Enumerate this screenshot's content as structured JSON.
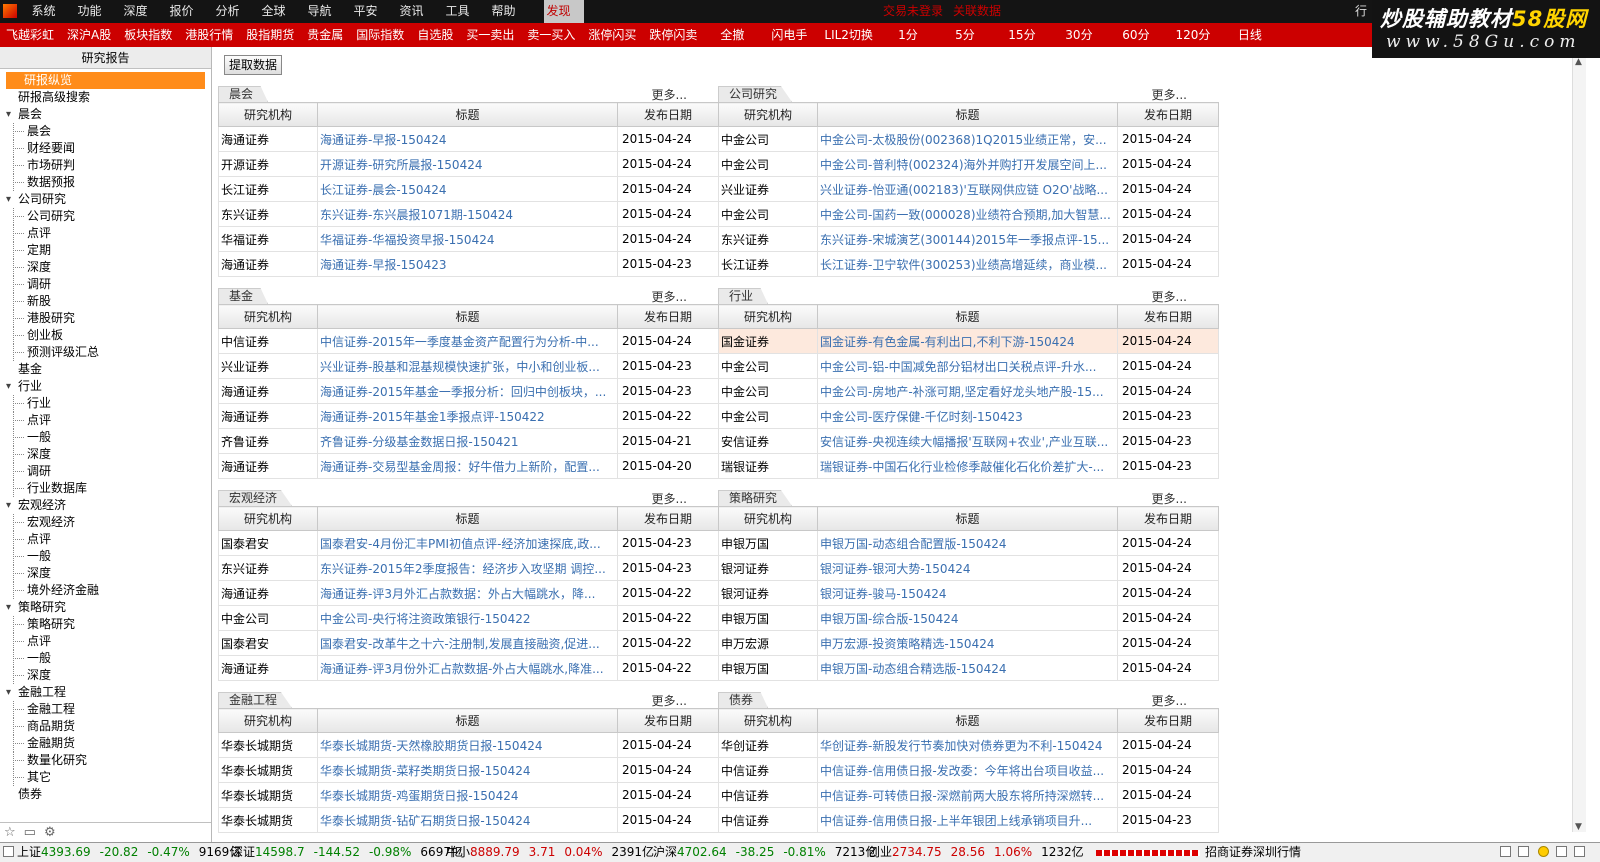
{
  "menubar": {
    "items": [
      "系统",
      "功能",
      "深度",
      "报价",
      "分析",
      "全球",
      "导航",
      "平安",
      "资讯",
      "工具",
      "帮助"
    ],
    "active": "发现",
    "center_links": [
      "交易未登录",
      "关联数据"
    ],
    "right": "行"
  },
  "watermark": {
    "line1_a": "炒股辅助教材",
    "line1_b": "58股网",
    "line2": "www.58Gu.com"
  },
  "toolbar": {
    "items": [
      "飞越彩虹",
      "深沪A股",
      "板块指数",
      "港股行情",
      "股指期货",
      "贵金属",
      "国际指数",
      "自选股",
      "买一卖出",
      "卖一买入",
      "涨停闪买",
      "跌停闪卖",
      "全撤",
      "闪电手",
      "LIL2切换",
      "1分",
      "5分",
      "15分",
      "30分",
      "60分",
      "120分",
      "日线"
    ]
  },
  "sidebar": {
    "title": "研究报告",
    "tree": [
      {
        "label": "研报纵览",
        "level": 0,
        "sel": true
      },
      {
        "label": "研报高级搜索",
        "level": 0
      },
      {
        "label": "晨会",
        "level": 0,
        "toggle": true
      },
      {
        "label": "晨会",
        "level": 1
      },
      {
        "label": "财经要闻",
        "level": 1
      },
      {
        "label": "市场研判",
        "level": 1
      },
      {
        "label": "数据预报",
        "level": 1
      },
      {
        "label": "公司研究",
        "level": 0,
        "toggle": true
      },
      {
        "label": "公司研究",
        "level": 1
      },
      {
        "label": "点评",
        "level": 1
      },
      {
        "label": "定期",
        "level": 1
      },
      {
        "label": "深度",
        "level": 1
      },
      {
        "label": "调研",
        "level": 1
      },
      {
        "label": "新股",
        "level": 1
      },
      {
        "label": "港股研究",
        "level": 1
      },
      {
        "label": "创业板",
        "level": 1
      },
      {
        "label": "预测评级汇总",
        "level": 1
      },
      {
        "label": "基金",
        "level": 0
      },
      {
        "label": "行业",
        "level": 0,
        "toggle": true
      },
      {
        "label": "行业",
        "level": 1
      },
      {
        "label": "点评",
        "level": 1
      },
      {
        "label": "一般",
        "level": 1
      },
      {
        "label": "深度",
        "level": 1
      },
      {
        "label": "调研",
        "level": 1
      },
      {
        "label": "行业数据库",
        "level": 1
      },
      {
        "label": "宏观经济",
        "level": 0,
        "toggle": true
      },
      {
        "label": "宏观经济",
        "level": 1
      },
      {
        "label": "点评",
        "level": 1
      },
      {
        "label": "一般",
        "level": 1
      },
      {
        "label": "深度",
        "level": 1
      },
      {
        "label": "境外经济金融",
        "level": 1
      },
      {
        "label": "策略研究",
        "level": 0,
        "toggle": true
      },
      {
        "label": "策略研究",
        "level": 1
      },
      {
        "label": "点评",
        "level": 1
      },
      {
        "label": "一般",
        "level": 1
      },
      {
        "label": "深度",
        "level": 1
      },
      {
        "label": "金融工程",
        "level": 0,
        "toggle": true
      },
      {
        "label": "金融工程",
        "level": 1
      },
      {
        "label": "商品期货",
        "level": 1
      },
      {
        "label": "金融期货",
        "level": 1
      },
      {
        "label": "数量化研究",
        "level": 1
      },
      {
        "label": "其它",
        "level": 1
      },
      {
        "label": "债券",
        "level": 0
      }
    ]
  },
  "main": {
    "extract_button": "提取数据",
    "more_label": "更多...",
    "headers": [
      "研究机构",
      "标题",
      "发布日期"
    ],
    "panels": [
      {
        "name": "晨会",
        "rows": [
          [
            "海通证券",
            "海通证券-早报-150424",
            "2015-04-24"
          ],
          [
            "开源证券",
            "开源证券-研究所晨报-150424",
            "2015-04-24"
          ],
          [
            "长江证券",
            "长江证券-晨会-150424",
            "2015-04-24"
          ],
          [
            "东兴证券",
            "东兴证券-东兴晨报1071期-150424",
            "2015-04-24"
          ],
          [
            "华福证券",
            "华福证券-华福投资早报-150424",
            "2015-04-24"
          ],
          [
            "海通证券",
            "海通证券-早报-150423",
            "2015-04-23"
          ]
        ]
      },
      {
        "name": "公司研究",
        "rows": [
          [
            "中金公司",
            "中金公司-太极股份(002368)1Q2015业绩正常，安...",
            "2015-04-24"
          ],
          [
            "中金公司",
            "中金公司-普利特(002324)海外并购打开发展空间上...",
            "2015-04-24"
          ],
          [
            "兴业证券",
            "兴业证券-怡亚通(002183)'互联网供应链 O2O'战略...",
            "2015-04-24"
          ],
          [
            "中金公司",
            "中金公司-国药一致(000028)业绩符合预期,加大智慧...",
            "2015-04-24"
          ],
          [
            "东兴证券",
            "东兴证券-宋城演艺(300144)2015年一季报点评-15...",
            "2015-04-24"
          ],
          [
            "长江证券",
            "长江证券-卫宁软件(300253)业绩高增延续，商业模...",
            "2015-04-24"
          ]
        ]
      },
      {
        "name": "基金",
        "rows": [
          [
            "中信证券",
            "中信证券-2015年一季度基金资产配置行为分析-中...",
            "2015-04-24"
          ],
          [
            "兴业证券",
            "兴业证券-股基和混基规模快速扩张，中小和创业板...",
            "2015-04-23"
          ],
          [
            "海通证券",
            "海通证券-2015年基金一季报分析：回归中创板块，...",
            "2015-04-23"
          ],
          [
            "海通证券",
            "海通证券-2015年基金1季报点评-150422",
            "2015-04-22"
          ],
          [
            "齐鲁证券",
            "齐鲁证券-分级基金数据日报-150421",
            "2015-04-21"
          ],
          [
            "海通证券",
            "海通证券-交易型基金周报：好牛借力上新阶，配置...",
            "2015-04-20"
          ]
        ]
      },
      {
        "name": "行业",
        "rows": [
          [
            "国金证券",
            "国金证券-有色金属-有利出口,不利下游-150424",
            "2015-04-24"
          ],
          [
            "中金公司",
            "中金公司-铝-中国减免部分铝材出口关税点评-升水...",
            "2015-04-24"
          ],
          [
            "中金公司",
            "中金公司-房地产-补涨可期,坚定看好龙头地产股-15...",
            "2015-04-24"
          ],
          [
            "中金公司",
            "中金公司-医疗保健-千亿时刻-150423",
            "2015-04-23"
          ],
          [
            "安信证券",
            "安信证券-央视连续大幅播报'互联网+农业',产业互联...",
            "2015-04-23"
          ],
          [
            "瑞银证券",
            "瑞银证券-中国石化行业检修季敲催化石化价差扩大-...",
            "2015-04-23"
          ]
        ]
      },
      {
        "name": "宏观经济",
        "rows": [
          [
            "国泰君安",
            "国泰君安-4月份汇丰PMI初值点评-经济加速探底,政...",
            "2015-04-23"
          ],
          [
            "东兴证券",
            "东兴证券-2015年2季度报告：经济步入攻坚期 调控...",
            "2015-04-23"
          ],
          [
            "海通证券",
            "海通证券-评3月外汇占款数据：外占大幅跳水，降...",
            "2015-04-22"
          ],
          [
            "中金公司",
            "中金公司-央行将注资政策银行-150422",
            "2015-04-22"
          ],
          [
            "国泰君安",
            "国泰君安-改革牛之十六-注册制,发展直接融资,促进...",
            "2015-04-22"
          ],
          [
            "海通证券",
            "海通证券-评3月份外汇占款数据-外占大幅跳水,降准...",
            "2015-04-22"
          ]
        ]
      },
      {
        "name": "策略研究",
        "rows": [
          [
            "申银万国",
            "申银万国-动态组合配置版-150424",
            "2015-04-24"
          ],
          [
            "银河证券",
            "银河证券-银河大势-150424",
            "2015-04-24"
          ],
          [
            "银河证券",
            "银河证券-骏马-150424",
            "2015-04-24"
          ],
          [
            "申银万国",
            "申银万国-综合版-150424",
            "2015-04-24"
          ],
          [
            "申万宏源",
            "申万宏源-投资策略精选-150424",
            "2015-04-24"
          ],
          [
            "申银万国",
            "申银万国-动态组合精选版-150424",
            "2015-04-24"
          ]
        ]
      },
      {
        "name": "金融工程",
        "rows": [
          [
            "华泰长城期货",
            "华泰长城期货-天然橡胶期货日报-150424",
            "2015-04-24"
          ],
          [
            "华泰长城期货",
            "华泰长城期货-菜籽类期货日报-150424",
            "2015-04-24"
          ],
          [
            "华泰长城期货",
            "华泰长城期货-鸡蛋期货日报-150424",
            "2015-04-24"
          ],
          [
            "华泰长城期货",
            "华泰长城期货-钻矿石期货日报-150424",
            "2015-04-24"
          ]
        ]
      },
      {
        "name": "债券",
        "rows": [
          [
            "华创证券",
            "华创证券-新股发行节奏加快对债券更为不利-150424",
            "2015-04-24"
          ],
          [
            "中信证券",
            "中信证券-信用债日报-发改委：今年将出台项目收益...",
            "2015-04-24"
          ],
          [
            "中信证券",
            "中信证券-可转债日报-深燃前两大股东将所持深燃转...",
            "2015-04-24"
          ],
          [
            "中信证券",
            "中信证券-信用债日报-上半年银团上线承销项目升...",
            "2015-04-23"
          ]
        ]
      }
    ]
  },
  "status": {
    "items": [
      {
        "name": "上证",
        "price": "4393.69",
        "chg": "-20.82",
        "pct": "-0.47%",
        "vol": "9169亿"
      },
      {
        "name": "深证",
        "price": "14598.7",
        "chg": "-144.52",
        "pct": "-0.98%",
        "vol": "6697亿"
      },
      {
        "name": "中小",
        "price": "8889.79",
        "chg": "3.71",
        "pct": "0.04%",
        "vol": "2391亿"
      },
      {
        "name": "沪深",
        "price": "4702.64",
        "chg": "-38.25",
        "pct": "-0.81%",
        "vol": "7213亿"
      },
      {
        "name": "创业",
        "price": "2734.75",
        "chg": "28.56",
        "pct": "1.06%",
        "vol": "1232亿"
      }
    ],
    "broker": "招商证券深圳行情"
  },
  "colors": {
    "accent_red": "#cc0000",
    "selection_orange": "#ff8c1a",
    "link_blue": "#3a6fb0",
    "down_green": "#008000"
  }
}
